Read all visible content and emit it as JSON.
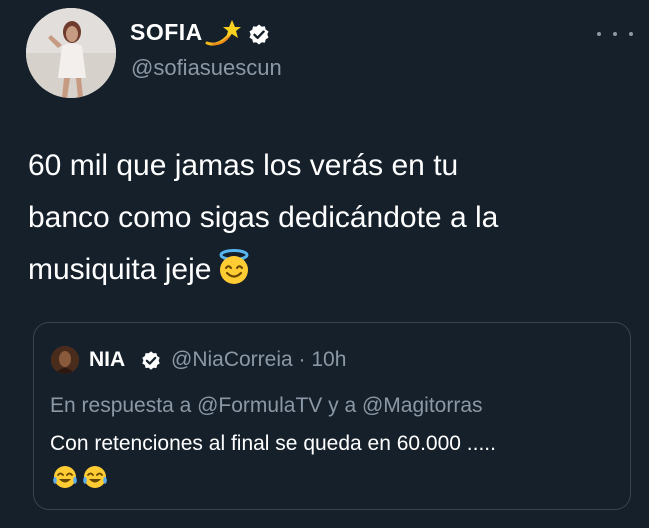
{
  "tweet": {
    "author": {
      "name": "SOFIA",
      "name_emoji": "dizzy-icon",
      "verified": true,
      "handle": "@sofiasuescun"
    },
    "text_lines": [
      "60 mil que jamas los verás en tu",
      "banco como sigas dedicándote a la",
      "musiquita jeje"
    ],
    "text_emoji": "smiling-face-with-halo-icon",
    "quoted": {
      "name": "NIA",
      "verified": true,
      "handle": "@NiaCorreia",
      "time": "10h",
      "reply_prefix": "En respuesta a",
      "reply_to_1": "@FormulaTV",
      "reply_joiner": "y a",
      "reply_to_2": "@Magitorras",
      "text": "Con retenciones al final se queda en 60.000 .....",
      "emojis": [
        "face-with-tears-of-joy-icon",
        "face-with-tears-of-joy-icon"
      ]
    }
  },
  "colors": {
    "background": "#15202b",
    "text": "#ffffff",
    "muted": "#8b98a5",
    "border": "#38444d",
    "verified": "#ffffff"
  }
}
